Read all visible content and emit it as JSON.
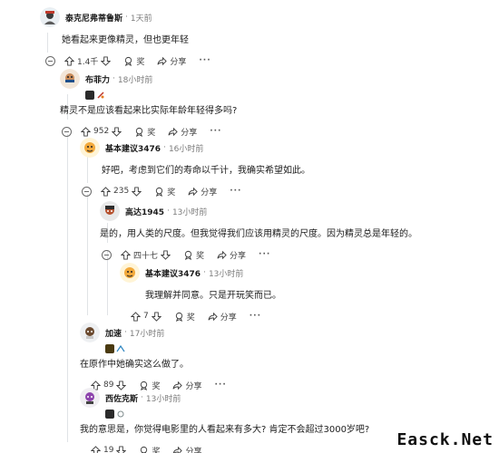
{
  "comments": [
    {
      "author": "泰克尼弗蒂鲁斯",
      "time": "1天前",
      "text": "她看起来更像精灵，但也更年轻",
      "votes": "1.4千",
      "award_label": "奖",
      "share_label": "分享",
      "more_label": "···"
    },
    {
      "author": "布菲力",
      "time": "18小时前",
      "text": "精灵不是应该看起来比实际年龄年轻得多吗?",
      "votes": "952",
      "award_label": "奖",
      "share_label": "分享",
      "more_label": "···"
    },
    {
      "author": "基本建议3476",
      "time": "16小时前",
      "text": "好吧，考虑到它们的寿命以千计，我确实希望如此。",
      "votes": "235",
      "award_label": "奖",
      "share_label": "分享",
      "more_label": "···"
    },
    {
      "author": "高达1945",
      "time": "13小时前",
      "text": "是的，用人类的尺度。但我觉得我们应该用精灵的尺度。因为精灵总是年轻的。",
      "votes": "四十七",
      "award_label": "奖",
      "share_label": "分享",
      "more_label": "···"
    },
    {
      "author": "基本建议3476",
      "time": "13小时前",
      "text": "我理解并同意。只是开玩笑而已。",
      "votes": "7",
      "award_label": "奖",
      "share_label": "分享",
      "more_label": "···"
    },
    {
      "author": "加速",
      "time": "17小时前",
      "text": "在原作中她确实这么做了。",
      "votes": "89",
      "award_label": "奖",
      "share_label": "分享",
      "more_label": "···"
    },
    {
      "author": "西佐克斯",
      "time": "13小时前",
      "text": "我的意思是，你觉得电影里的人看起来有多大? 肯定不会超过3000岁吧?",
      "votes": "19",
      "award_label": "奖",
      "share_label": "分享",
      "more_label": "···"
    }
  ],
  "separator": "·",
  "watermark": "Easck.Net",
  "colors": {
    "thread_line": "#e0e3e6",
    "meta_gray": "#7c7c7c",
    "text": "#1c1c1c"
  }
}
